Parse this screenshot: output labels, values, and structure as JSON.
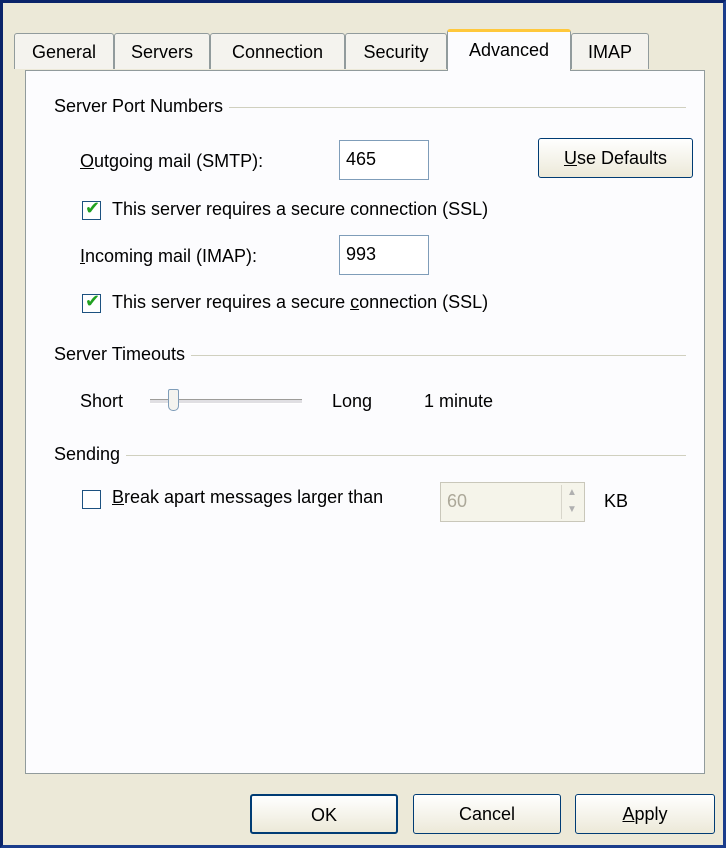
{
  "tabs": [
    {
      "label": "General"
    },
    {
      "label": "Servers"
    },
    {
      "label": "Connection"
    },
    {
      "label": "Security"
    },
    {
      "label": "Advanced"
    },
    {
      "label": "IMAP"
    }
  ],
  "active_tab": "Advanced",
  "ports": {
    "group_title": "Server Port Numbers",
    "outgoing_label_mnemonic": "O",
    "outgoing_label_rest": "utgoing mail (SMTP):",
    "outgoing_value": "465",
    "use_defaults_mnemonic": "U",
    "use_defaults_rest": "se Defaults",
    "ssl_outgoing_label": "This server requires a secure connection (SSL)",
    "ssl_outgoing_checked": true,
    "incoming_label_mnemonic": "I",
    "incoming_label_rest": "ncoming mail (IMAP):",
    "incoming_value": "993",
    "ssl_incoming_pre": "This server requires a secure ",
    "ssl_incoming_mnemonic": "c",
    "ssl_incoming_post": "onnection (SSL)",
    "ssl_incoming_checked": true
  },
  "timeouts": {
    "group_title": "Server Timeouts",
    "short_label": "Short",
    "long_label": "Long",
    "value_text": "1 minute"
  },
  "sending": {
    "group_title": "Sending",
    "break_mnemonic": "B",
    "break_rest": "reak apart messages larger than",
    "break_checked": false,
    "size_value": "60",
    "unit_label": "KB"
  },
  "footer": {
    "ok_label": "OK",
    "cancel_label": "Cancel",
    "apply_mnemonic": "A",
    "apply_rest": "pply"
  },
  "colors": {
    "face": "#ece9d8",
    "panel": "#fcfcfe",
    "active_tab_accent": "#ffc83c",
    "check_green": "#21a121",
    "textbox_border": "#7f9db9"
  },
  "icons": [
    "checkmark-icon",
    "slider-thumb-icon",
    "spin-up-icon",
    "spin-down-icon"
  ]
}
